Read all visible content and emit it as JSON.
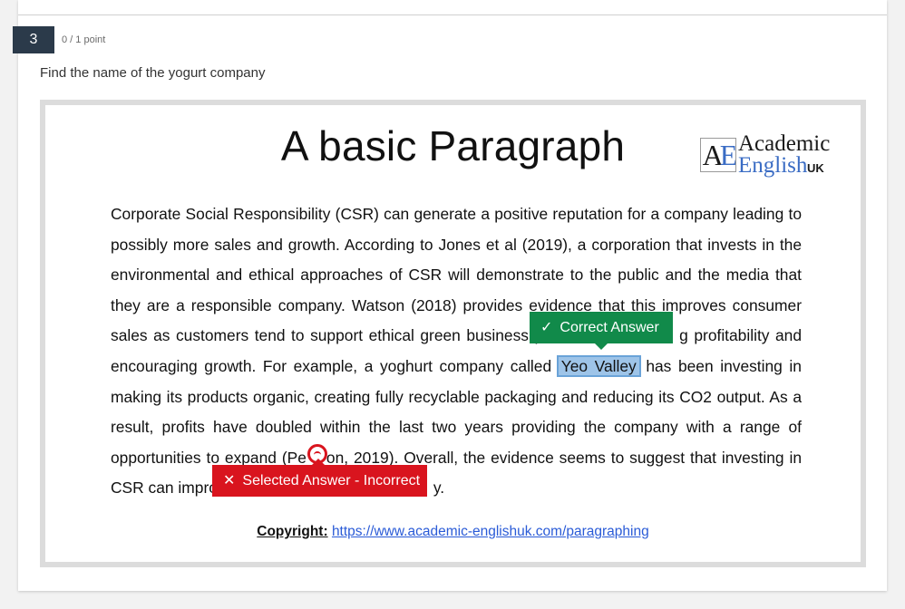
{
  "question": {
    "number": "3",
    "points": "0 / 1 point",
    "prompt": "Find the name of the yogurt company"
  },
  "document": {
    "title": "A basic Paragraph",
    "logo": {
      "mark_a": "A",
      "mark_e": "E",
      "academic": "Academic",
      "english": "English",
      "uk": "UK"
    },
    "lines": {
      "l1": "Corporate Social Responsibility (CSR) can generate a positive reputation for a company leading to",
      "l2": "possibly more sales and growth. According to Jones et al (2019), a corporation that invests in the",
      "l3": "environmental and ethical approaches of CSR will demonstrate to the public and the media that",
      "l4": "they are a responsible company. Watson (2018) provides evidence that this improves consumer",
      "l5a": "sales as customers tend to support ethical green business p",
      "l5b": "g profitability and",
      "l6a": "encouraging growth. For example, a yoghurt company called",
      "l6b": "Yeo Valley",
      "l6c": "has been investing in",
      "l7": "making its products organic, creating fully recyclable packaging and reducing its CO2 output. As a",
      "l8": "result, profits have doubled within the last two years providing the company with a range of",
      "l9a": "opportunities to expand (Pe",
      "l9b": "on, 2019). Overall, the evidence seems to suggest that investing in",
      "l10a": "CSR can impro",
      "l10b": "y."
    },
    "copyright_label": "Copyright:",
    "copyright_url": "https://www.academic-englishuk.com/paragraphing"
  },
  "feedback": {
    "correct_label": "Correct Answer",
    "correct_icon": "checkmark-icon",
    "incorrect_label": "Selected Answer - Incorrect",
    "incorrect_icon": "x-icon",
    "colors": {
      "correct": "#118a4a",
      "incorrect": "#d9141e",
      "highlight": "#9ec4e8"
    }
  }
}
